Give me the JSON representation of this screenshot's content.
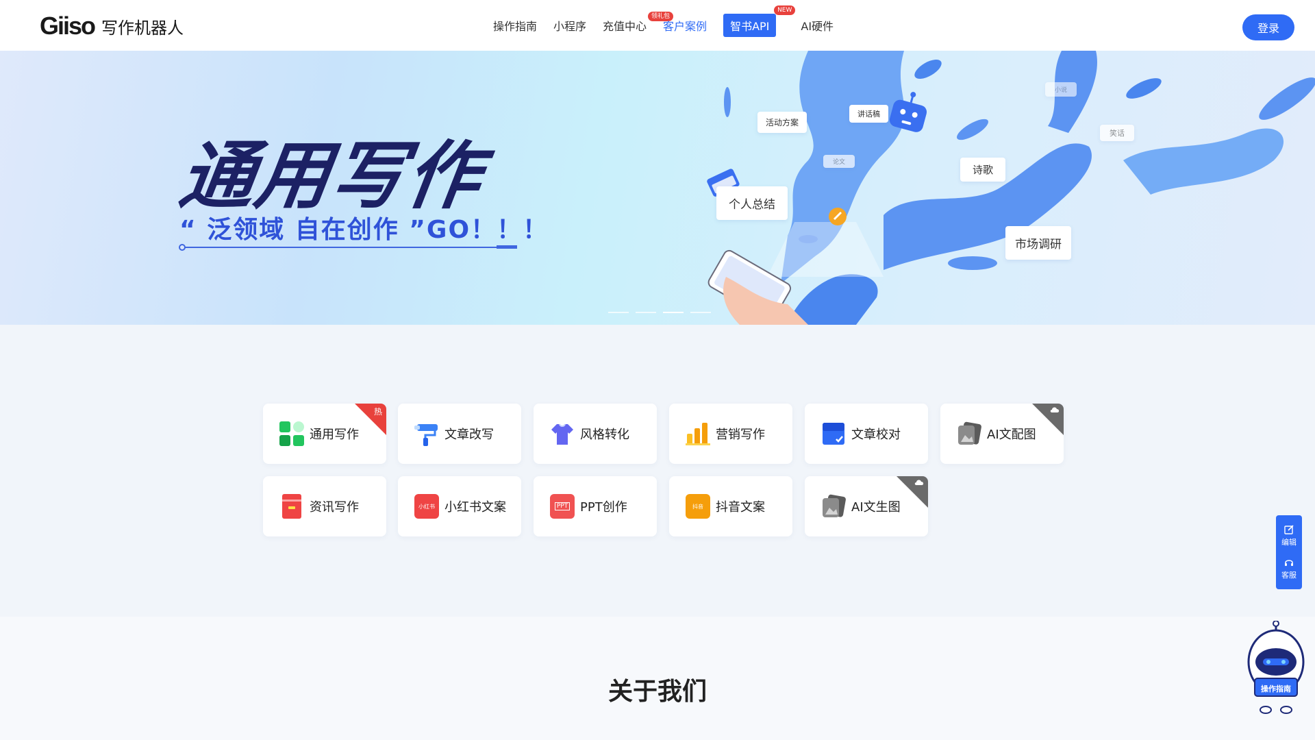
{
  "header": {
    "logo_mark": "Giiso",
    "logo_text": "写作机器人",
    "nav": [
      {
        "label": "操作指南"
      },
      {
        "label": "小程序"
      },
      {
        "label": "充值中心",
        "badge": "领礼包"
      },
      {
        "label": "客户案例"
      },
      {
        "label": "智书API",
        "badge": "NEW"
      },
      {
        "label": "AI硬件"
      }
    ],
    "login_label": "登录"
  },
  "banner": {
    "title": "通用写作",
    "subtitle": "“ 泛领域 自在创作 ”GO！！！",
    "bubbles": [
      "活动方案",
      "讲话稿",
      "小说",
      "笑话",
      "论文",
      "诗歌",
      "个人总结",
      "市场调研"
    ]
  },
  "tools": [
    {
      "label": "通用写作",
      "icon": "grid-icon",
      "color": "#22c55e",
      "corner": "热"
    },
    {
      "label": "文章改写",
      "icon": "paint-roller-icon",
      "color": "#3b82f6"
    },
    {
      "label": "风格转化",
      "icon": "shirt-icon",
      "color": "#6366f1"
    },
    {
      "label": "营销写作",
      "icon": "bar-chart-icon",
      "color": "#f59e0b"
    },
    {
      "label": "文章校对",
      "icon": "check-doc-icon",
      "color": "#2f6bf5"
    },
    {
      "label": "AI文配图",
      "icon": "image-stack-icon",
      "color": "#5b5b5b",
      "corner_icon": "cloud-icon"
    },
    {
      "label": "资讯写作",
      "icon": "news-icon",
      "color": "#ef4444"
    },
    {
      "label": "小红书文案",
      "icon": "xiaohongshu-icon",
      "color": "#ef4444",
      "icon_text": "小红书"
    },
    {
      "label": "PPT创作",
      "icon": "ppt-icon",
      "color": "#f05252",
      "icon_text": "PPT"
    },
    {
      "label": "抖音文案",
      "icon": "douyin-icon",
      "color": "#f59e0b",
      "icon_text": "抖音"
    },
    {
      "label": "AI文生图",
      "icon": "image-stack-icon",
      "color": "#5b5b5b",
      "corner_icon": "cloud-icon"
    }
  ],
  "side": {
    "edit_label": "编辑",
    "service_label": "客服"
  },
  "robot": {
    "label": "操作指南"
  },
  "about": {
    "title": "关于我们"
  },
  "colors": {
    "brand": "#2f6bf5",
    "hot": "#e8413c",
    "banner_title": "#1c2164"
  }
}
